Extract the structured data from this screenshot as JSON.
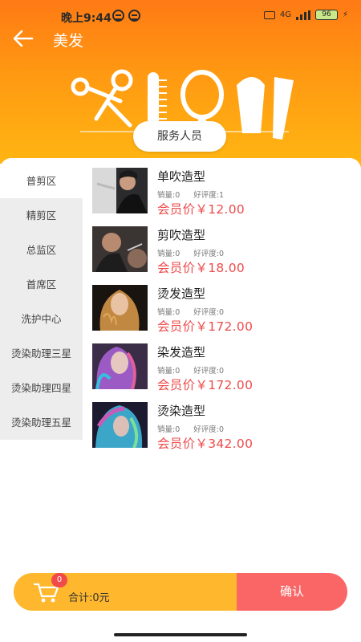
{
  "status_bar": {
    "time": "晚上9:44",
    "network": "4G",
    "battery": "96"
  },
  "nav": {
    "title": "美发"
  },
  "hero": {
    "service_label": "服务人员"
  },
  "sidebar": {
    "items": [
      {
        "label": "普剪区",
        "active": true
      },
      {
        "label": "精剪区",
        "active": false
      },
      {
        "label": "总监区",
        "active": false
      },
      {
        "label": "首席区",
        "active": false
      },
      {
        "label": "洗护中心",
        "active": false
      },
      {
        "label": "烫染助理三星",
        "active": false
      },
      {
        "label": "烫染助理四星",
        "active": false
      },
      {
        "label": "烫染助理五星",
        "active": false
      }
    ]
  },
  "products": [
    {
      "name": "单吹造型",
      "sales": "销量:0",
      "rating": "好评度:1",
      "price": "会员价￥12.00"
    },
    {
      "name": "剪吹造型",
      "sales": "销量:0",
      "rating": "好评度:0",
      "price": "会员价￥18.00"
    },
    {
      "name": "烫发造型",
      "sales": "销量:0",
      "rating": "好评度:0",
      "price": "会员价￥172.00"
    },
    {
      "name": "染发造型",
      "sales": "销量:0",
      "rating": "好评度:0",
      "price": "会员价￥172.00"
    },
    {
      "name": "烫染造型",
      "sales": "销量:0",
      "rating": "好评度:0",
      "price": "会员价￥342.00"
    }
  ],
  "cart": {
    "badge": "0",
    "total": "合计:0元",
    "confirm_label": "确认"
  },
  "colors": {
    "header_top": "#ff7a14",
    "header_bottom": "#ffb812",
    "cart_bar": "#ffb82e",
    "confirm": "#fa6666",
    "price": "#ee4b4b"
  }
}
